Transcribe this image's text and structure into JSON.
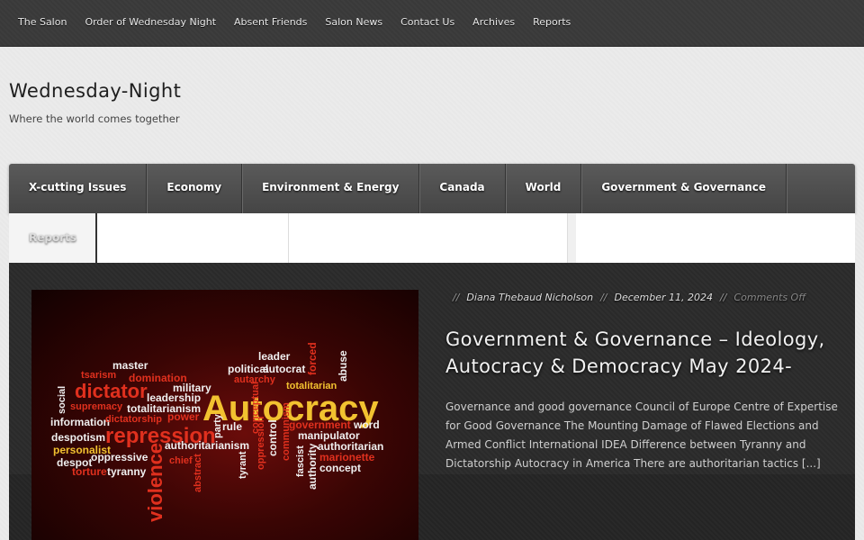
{
  "topnav": [
    "The Salon",
    "Order of Wednesday Night",
    "Absent Friends",
    "Salon News",
    "Contact Us",
    "Archives",
    "Reports"
  ],
  "site": {
    "title": "Wednesday-Night",
    "tagline": "Where the world comes together"
  },
  "categories": [
    "X-cutting Issues",
    "Economy",
    "Environment & Energy",
    "Canada",
    "World",
    "Government & Governance"
  ],
  "categories_row2": [
    "Reports"
  ],
  "featured": {
    "author": "Diana Thebaud Nicholson",
    "date": "December 11, 2024",
    "comments": "Comments Off",
    "meta_sep": "//",
    "title": "Government & Governance – Ideology, Autocracy & Democracy May 2024-",
    "excerpt": "Governance and good governance Council of Europe Centre of Expertise for Good Governance The Mounting Damage of Flawed Elections and Armed Conflict International IDEA Difference between Tyranny and Dictatorship Autocracy in America There are authoritarian tactics [...]",
    "image_words": [
      "master",
      "tsarism",
      "domination",
      "leader",
      "political",
      "autocrat",
      "forced",
      "abuse",
      "dictator",
      "military",
      "autarchy",
      "totalitarian",
      "social",
      "supremacy",
      "leadership",
      "Autocracy",
      "information",
      "totalitarianism",
      "dictatorship",
      "power",
      "despotism",
      "repression",
      "party",
      "rule",
      "government",
      "word",
      "personalist",
      "authoritarianism",
      "conceptual",
      "control",
      "manipulator",
      "despot",
      "oppressive",
      "oppression",
      "communism",
      "authoritarian",
      "torture",
      "tyranny",
      "chief",
      "tyrant",
      "fascist",
      "marionette",
      "violence",
      "abstract",
      "authority",
      "concept"
    ]
  },
  "colors": {
    "topbar": "#3a3a3a",
    "catnav": "#4e4e4e",
    "featured_bg": "#2b2b2b",
    "word_red": "#e0301e",
    "word_yellow": "#f2c230",
    "word_white": "#f0f0f0"
  }
}
